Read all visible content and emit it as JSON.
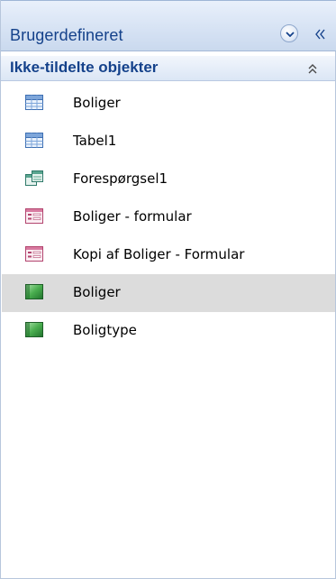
{
  "pane": {
    "title": "Brugerdefineret",
    "dropdown_icon": "chevron-down-icon",
    "collapse_icon": "double-chevron-left-icon"
  },
  "group": {
    "title": "Ikke-tildelte objekter",
    "toggle_icon": "double-chevron-up-icon"
  },
  "items": [
    {
      "label": "Boliger",
      "icon": "table-icon",
      "selected": false
    },
    {
      "label": "Tabel1",
      "icon": "table-icon",
      "selected": false
    },
    {
      "label": "Forespørgsel1",
      "icon": "query-icon",
      "selected": false
    },
    {
      "label": "Boliger - formular",
      "icon": "form-icon",
      "selected": false
    },
    {
      "label": "Kopi af Boliger - Formular",
      "icon": "form-icon",
      "selected": false
    },
    {
      "label": "Boliger",
      "icon": "macro-icon",
      "selected": true
    },
    {
      "label": "Boligtype",
      "icon": "macro-icon",
      "selected": false
    }
  ],
  "colors": {
    "header_text": "#15428b",
    "selected_row": "#dcdcdc",
    "pane_border": "#b7c6dc"
  }
}
